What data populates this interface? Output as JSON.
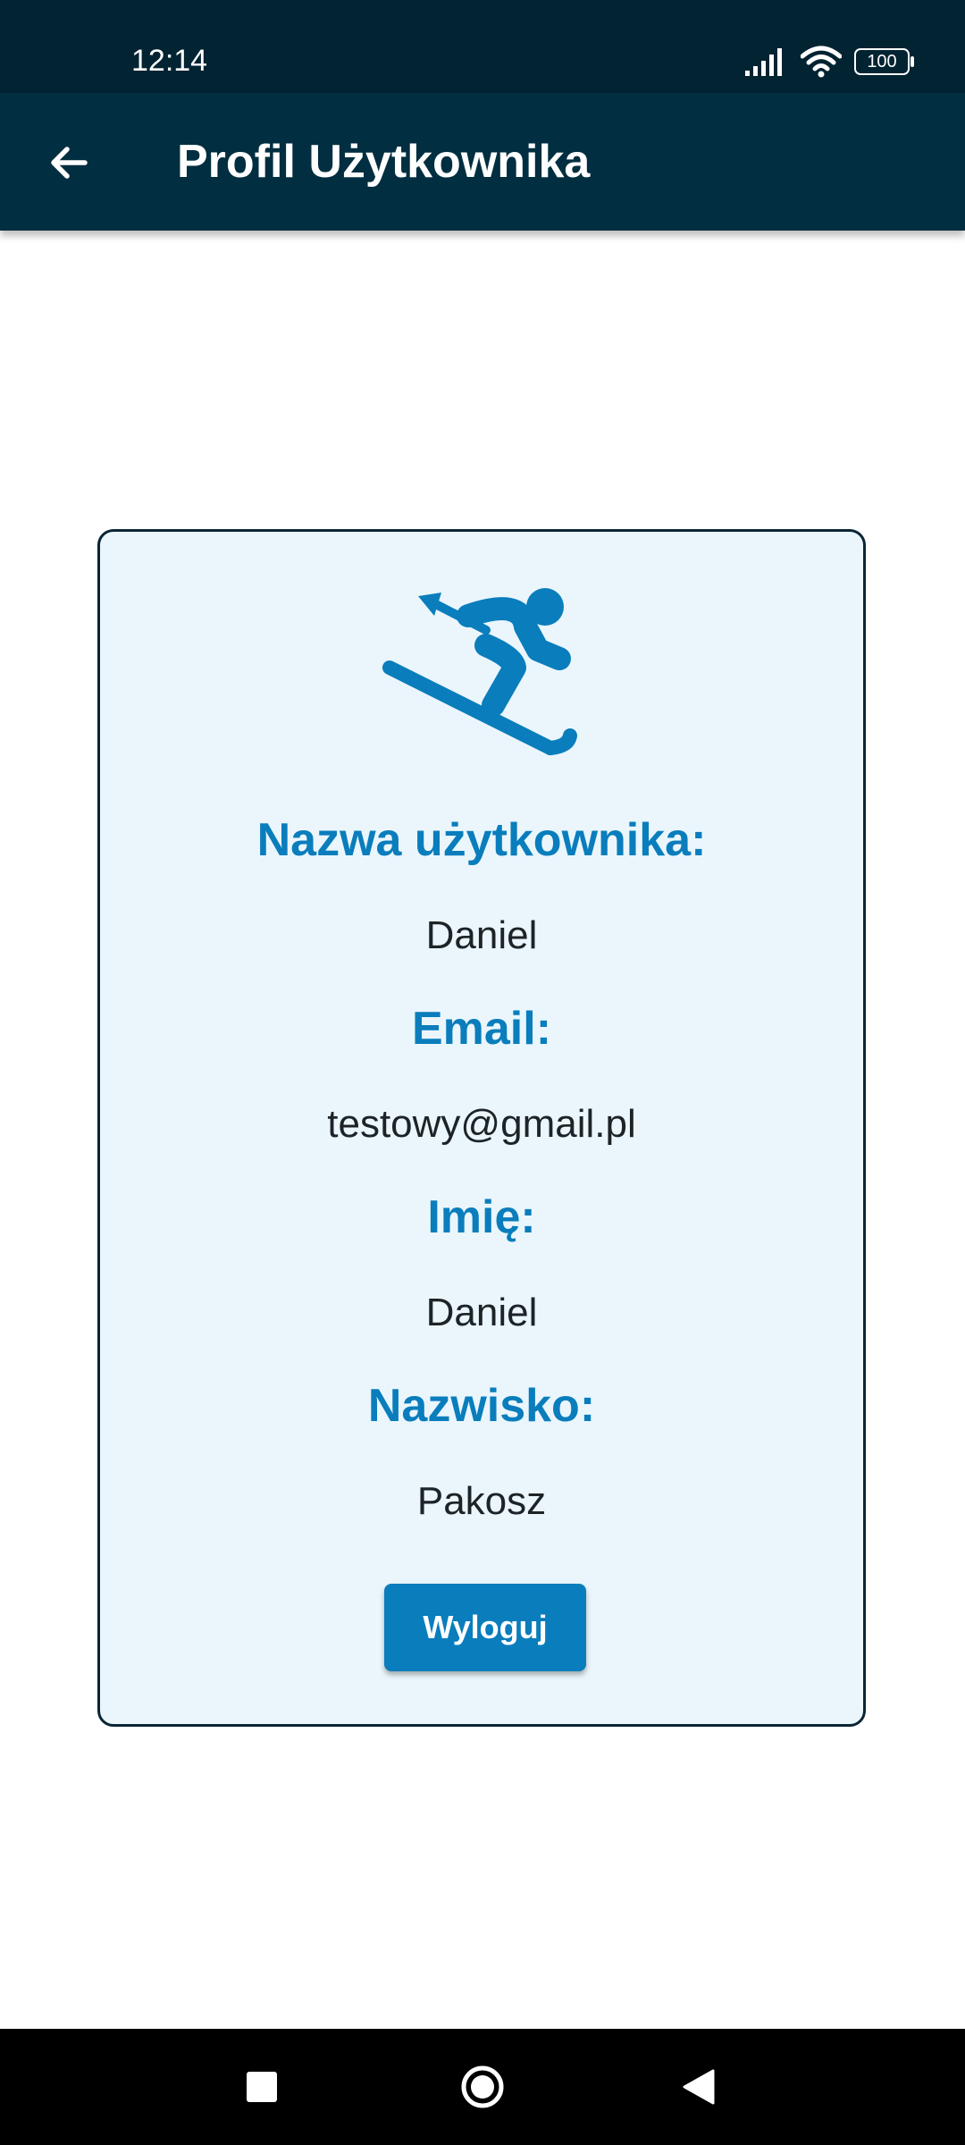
{
  "status_bar": {
    "time": "12:14",
    "battery": "100",
    "icons": [
      "signal-icon",
      "wifi-icon",
      "battery-icon"
    ]
  },
  "app_bar": {
    "title": "Profil Użytkownika",
    "back_icon": "arrow-left-icon"
  },
  "profile": {
    "avatar_icon": "skier-icon",
    "fields": [
      {
        "label": "Nazwa użytkownika:",
        "value": "Daniel"
      },
      {
        "label": "Email:",
        "value": "testowy@gmail.pl"
      },
      {
        "label": "Imię:",
        "value": "Daniel"
      },
      {
        "label": "Nazwisko:",
        "value": "Pakosz"
      }
    ],
    "logout_label": "Wyloguj"
  },
  "nav_bar": {
    "icons": [
      "recents-square-icon",
      "home-circle-icon",
      "back-triangle-icon"
    ]
  },
  "colors": {
    "status_bar": "#022332",
    "app_bar": "#012e40",
    "accent": "#0a7dbc",
    "card_background": "#eaf6fc",
    "card_border": "#0b2535"
  }
}
